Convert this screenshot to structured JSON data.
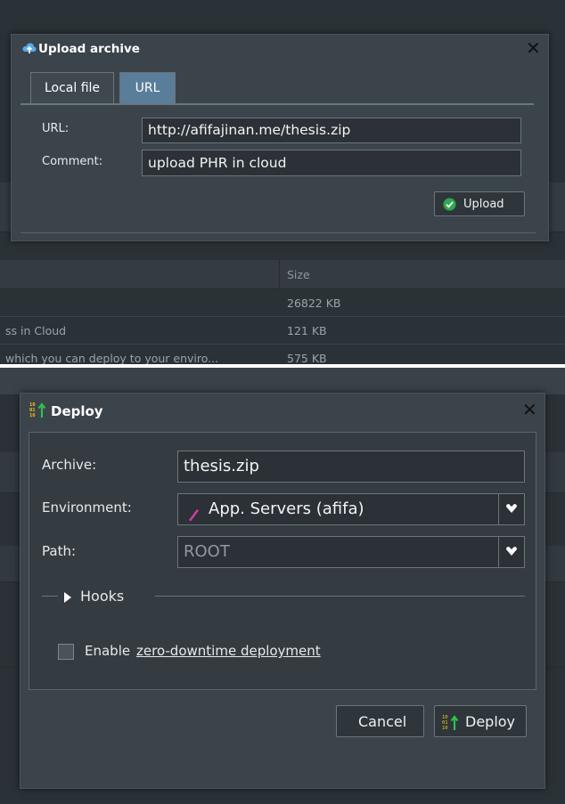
{
  "upload": {
    "title": "Upload archive",
    "tabs": [
      "Local file",
      "URL"
    ],
    "active_tab": "URL",
    "url_label": "URL:",
    "url_value": "http://afifajinan.me/thesis.zip",
    "comment_label": "Comment:",
    "comment_value": "upload PHR in cloud",
    "upload_button": "Upload"
  },
  "background_list": {
    "size_header": "Size",
    "rows": [
      {
        "name": "",
        "size": "26822 KB"
      },
      {
        "name": "ss in Cloud",
        "size": "121 KB"
      },
      {
        "name": "which you can deploy to your enviro...",
        "size": "575 KB"
      }
    ]
  },
  "deploy": {
    "title": "Deploy",
    "archive_label": "Archive:",
    "archive_value": "thesis.zip",
    "environment_label": "Environment:",
    "environment_value": "App. Servers (afifa)",
    "path_label": "Path:",
    "path_value": "ROOT",
    "hooks_label": "Hooks",
    "zdt_prefix": "Enable ",
    "zdt_link": "zero-downtime deployment",
    "cancel_button": "Cancel",
    "deploy_button": "Deploy"
  },
  "colors": {
    "dialog_bg": "#3b444b",
    "field_bg": "#2b3136",
    "accent_tab": "#5a7d9a",
    "green_icon": "#2fa84f",
    "env_icon": "#d93aa8"
  },
  "icons": [
    "cloud-upload-icon",
    "close-icon",
    "check-circle-icon",
    "deploy-binary-icon",
    "pencil-icon",
    "chevron-down-icon",
    "caret-right-icon",
    "checkbox-icon"
  ]
}
